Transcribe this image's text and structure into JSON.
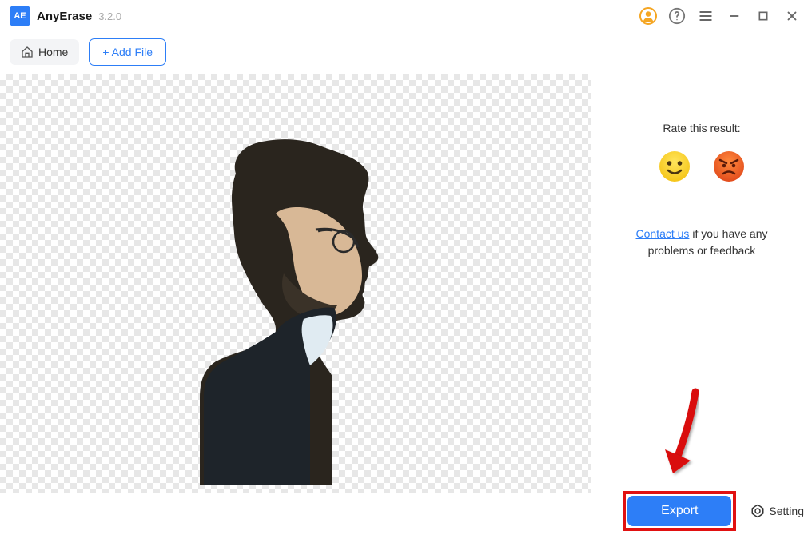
{
  "app": {
    "logo_text": "AE",
    "name": "AnyErase",
    "version": "3.2.0"
  },
  "toolbar": {
    "home_label": "Home",
    "add_file_label": "+ Add File"
  },
  "right_panel": {
    "rate_label": "Rate this result:",
    "contact_link": "Contact us",
    "feedback_suffix": " if you have any problems or feedback"
  },
  "bottom": {
    "export_label": "Export",
    "setting_label": "Setting"
  }
}
